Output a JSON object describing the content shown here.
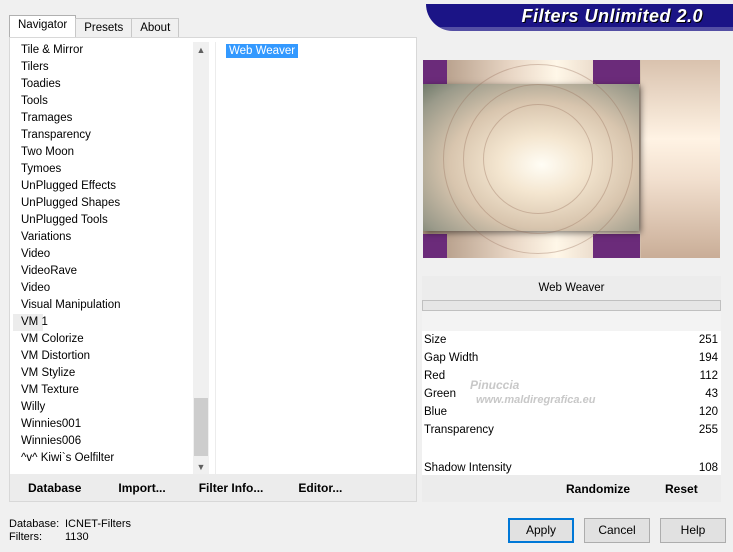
{
  "tabs": [
    "Navigator",
    "Presets",
    "About"
  ],
  "banner": {
    "title": "Filters Unlimited 2.0"
  },
  "categories": [
    "Tile & Mirror",
    "Tilers",
    "Toadies",
    "Tools",
    "Tramages",
    "Transparency",
    "Two Moon",
    "Tymoes",
    "UnPlugged Effects",
    "UnPlugged Shapes",
    "UnPlugged Tools",
    "Variations",
    "Video",
    "VideoRave",
    "Video",
    "Visual Manipulation",
    "VM 1",
    "VM Colorize",
    "VM Distortion",
    "VM Stylize",
    "VM Texture",
    "Willy",
    "Winnies001",
    "Winnies006",
    "^v^ Kiwi`s Oelfilter"
  ],
  "selected_category": "VM 1",
  "filters": [
    "Web Weaver"
  ],
  "bottom_bar": {
    "database": "Database",
    "import": "Import...",
    "filter_info": "Filter Info...",
    "editor": "Editor..."
  },
  "settings": {
    "title": "Web Weaver",
    "params": [
      {
        "label": "Size",
        "value": "251"
      },
      {
        "label": "Gap Width",
        "value": "194"
      },
      {
        "label": "Red",
        "value": "112"
      },
      {
        "label": "Green",
        "value": "43"
      },
      {
        "label": "Blue",
        "value": "120"
      },
      {
        "label": "Transparency",
        "value": "255"
      }
    ],
    "extra": {
      "label": "Shadow Intensity",
      "value": "108"
    },
    "randomize": "Randomize",
    "reset": "Reset"
  },
  "watermark": {
    "line1": "Pinuccia",
    "line2": "www.maldiregrafica.eu"
  },
  "status": {
    "db_label": "Database:",
    "db_value": "ICNET-Filters",
    "filters_label": "Filters:",
    "filters_value": "1130"
  },
  "buttons": {
    "apply": "Apply",
    "cancel": "Cancel",
    "help": "Help"
  },
  "colors": {
    "accent": "#1b1486",
    "selection": "#3399ff",
    "preview_corner": "#6b2b7a"
  }
}
